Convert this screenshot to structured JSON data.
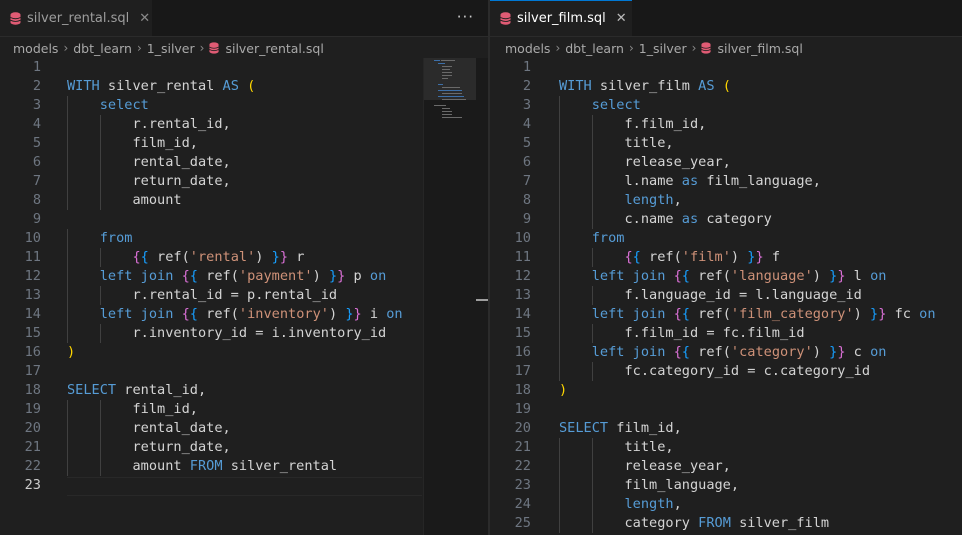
{
  "left_editor": {
    "tab": {
      "filename": "silver_rental.sql",
      "icon": "database-icon"
    },
    "more_actions": "···",
    "breadcrumb": {
      "parts": [
        "models",
        "dbt_learn",
        "1_silver"
      ],
      "file": "silver_rental.sql"
    },
    "lines": [
      [],
      [
        [
          "kw",
          "WITH"
        ],
        [
          "t",
          " silver_rental "
        ],
        [
          "kw",
          "AS"
        ],
        [
          "t",
          " "
        ],
        [
          "br1",
          "("
        ]
      ],
      [
        [
          "t",
          "    "
        ],
        [
          "kw",
          "select"
        ]
      ],
      [
        [
          "t",
          "        r.rental_id,"
        ]
      ],
      [
        [
          "t",
          "        film_id,"
        ]
      ],
      [
        [
          "t",
          "        rental_date,"
        ]
      ],
      [
        [
          "t",
          "        return_date,"
        ]
      ],
      [
        [
          "t",
          "        amount"
        ]
      ],
      [],
      [
        [
          "t",
          "    "
        ],
        [
          "kw",
          "from"
        ]
      ],
      [
        [
          "t",
          "        "
        ],
        [
          "br2",
          "{"
        ],
        [
          "br3",
          "{"
        ],
        [
          "t",
          " ref("
        ],
        [
          "str",
          "'rental'"
        ],
        [
          "t",
          ") "
        ],
        [
          "br3",
          "}"
        ],
        [
          "br2",
          "}"
        ],
        [
          "t",
          " r"
        ]
      ],
      [
        [
          "t",
          "    "
        ],
        [
          "kw",
          "left join"
        ],
        [
          "t",
          " "
        ],
        [
          "br2",
          "{"
        ],
        [
          "br3",
          "{"
        ],
        [
          "t",
          " ref("
        ],
        [
          "str",
          "'payment'"
        ],
        [
          "t",
          ") "
        ],
        [
          "br3",
          "}"
        ],
        [
          "br2",
          "}"
        ],
        [
          "t",
          " p "
        ],
        [
          "kw",
          "on"
        ]
      ],
      [
        [
          "t",
          "        r.rental_id = p.rental_id"
        ]
      ],
      [
        [
          "t",
          "    "
        ],
        [
          "kw",
          "left join"
        ],
        [
          "t",
          " "
        ],
        [
          "br2",
          "{"
        ],
        [
          "br3",
          "{"
        ],
        [
          "t",
          " ref("
        ],
        [
          "str",
          "'inventory'"
        ],
        [
          "t",
          ") "
        ],
        [
          "br3",
          "}"
        ],
        [
          "br2",
          "}"
        ],
        [
          "t",
          " i "
        ],
        [
          "kw",
          "on"
        ]
      ],
      [
        [
          "t",
          "        r.inventory_id = i.inventory_id"
        ]
      ],
      [
        [
          "br1",
          ")"
        ]
      ],
      [],
      [
        [
          "kw",
          "SELECT"
        ],
        [
          "t",
          " rental_id,"
        ]
      ],
      [
        [
          "t",
          "        film_id,"
        ]
      ],
      [
        [
          "t",
          "        rental_date,"
        ]
      ],
      [
        [
          "t",
          "        return_date,"
        ]
      ],
      [
        [
          "t",
          "        amount "
        ],
        [
          "kw",
          "FROM"
        ],
        [
          "t",
          " silver_rental"
        ]
      ],
      []
    ],
    "line_numbers": [
      "1",
      "2",
      "3",
      "4",
      "5",
      "6",
      "7",
      "8",
      "9",
      "10",
      "11",
      "12",
      "13",
      "14",
      "15",
      "16",
      "17",
      "18",
      "19",
      "20",
      "21",
      "22",
      "23"
    ],
    "current_line": 23
  },
  "right_editor": {
    "tab": {
      "filename": "silver_film.sql",
      "icon": "database-icon"
    },
    "breadcrumb": {
      "parts": [
        "models",
        "dbt_learn",
        "1_silver"
      ],
      "file": "silver_film.sql"
    },
    "lines": [
      [],
      [
        [
          "kw",
          "WITH"
        ],
        [
          "t",
          " silver_film "
        ],
        [
          "kw",
          "AS"
        ],
        [
          "t",
          " "
        ],
        [
          "br1",
          "("
        ]
      ],
      [
        [
          "t",
          "    "
        ],
        [
          "kw",
          "select"
        ]
      ],
      [
        [
          "t",
          "        f.film_id,"
        ]
      ],
      [
        [
          "t",
          "        title,"
        ]
      ],
      [
        [
          "t",
          "        release_year,"
        ]
      ],
      [
        [
          "t",
          "        l.name "
        ],
        [
          "kw",
          "as"
        ],
        [
          "t",
          " film_language,"
        ]
      ],
      [
        [
          "t",
          "        "
        ],
        [
          "kw",
          "length"
        ],
        [
          "t",
          ","
        ]
      ],
      [
        [
          "t",
          "        c.name "
        ],
        [
          "kw",
          "as"
        ],
        [
          "t",
          " category"
        ]
      ],
      [
        [
          "t",
          "    "
        ],
        [
          "kw",
          "from"
        ]
      ],
      [
        [
          "t",
          "        "
        ],
        [
          "br2",
          "{"
        ],
        [
          "br3",
          "{"
        ],
        [
          "t",
          " ref("
        ],
        [
          "str",
          "'film'"
        ],
        [
          "t",
          ") "
        ],
        [
          "br3",
          "}"
        ],
        [
          "br2",
          "}"
        ],
        [
          "t",
          " f"
        ]
      ],
      [
        [
          "t",
          "    "
        ],
        [
          "kw",
          "left join"
        ],
        [
          "t",
          " "
        ],
        [
          "br2",
          "{"
        ],
        [
          "br3",
          "{"
        ],
        [
          "t",
          " ref("
        ],
        [
          "str",
          "'language'"
        ],
        [
          "t",
          ") "
        ],
        [
          "br3",
          "}"
        ],
        [
          "br2",
          "}"
        ],
        [
          "t",
          " l "
        ],
        [
          "kw",
          "on"
        ]
      ],
      [
        [
          "t",
          "        f.language_id = l.language_id"
        ]
      ],
      [
        [
          "t",
          "    "
        ],
        [
          "kw",
          "left join"
        ],
        [
          "t",
          " "
        ],
        [
          "br2",
          "{"
        ],
        [
          "br3",
          "{"
        ],
        [
          "t",
          " ref("
        ],
        [
          "str",
          "'film_category'"
        ],
        [
          "t",
          ") "
        ],
        [
          "br3",
          "}"
        ],
        [
          "br2",
          "}"
        ],
        [
          "t",
          " fc "
        ],
        [
          "kw",
          "on"
        ]
      ],
      [
        [
          "t",
          "        f.film_id = fc.film_id"
        ]
      ],
      [
        [
          "t",
          "    "
        ],
        [
          "kw",
          "left join"
        ],
        [
          "t",
          " "
        ],
        [
          "br2",
          "{"
        ],
        [
          "br3",
          "{"
        ],
        [
          "t",
          " ref("
        ],
        [
          "str",
          "'category'"
        ],
        [
          "t",
          ") "
        ],
        [
          "br3",
          "}"
        ],
        [
          "br2",
          "}"
        ],
        [
          "t",
          " c "
        ],
        [
          "kw",
          "on"
        ]
      ],
      [
        [
          "t",
          "        fc.category_id = c.category_id"
        ]
      ],
      [
        [
          "br1",
          ")"
        ]
      ],
      [],
      [
        [
          "kw",
          "SELECT"
        ],
        [
          "t",
          " film_id,"
        ]
      ],
      [
        [
          "t",
          "        title,"
        ]
      ],
      [
        [
          "t",
          "        release_year,"
        ]
      ],
      [
        [
          "t",
          "        film_language,"
        ]
      ],
      [
        [
          "t",
          "        "
        ],
        [
          "kw",
          "length"
        ],
        [
          "t",
          ","
        ]
      ],
      [
        [
          "t",
          "        category "
        ],
        [
          "kw",
          "FROM"
        ],
        [
          "t",
          " silver_film"
        ]
      ]
    ],
    "line_numbers": [
      "1",
      "2",
      "3",
      "4",
      "5",
      "6",
      "7",
      "8",
      "9",
      "10",
      "11",
      "12",
      "13",
      "14",
      "15",
      "16",
      "17",
      "18",
      "19",
      "20",
      "21",
      "22",
      "23",
      "24",
      "25"
    ]
  },
  "colors": {
    "keyword": "#569cd6",
    "string": "#ce9178",
    "bracket_level1": "#ffd700",
    "bracket_level2": "#da70d6",
    "bracket_level3": "#179fff",
    "text": "#d4d4d4",
    "line_number": "#6e7681"
  }
}
